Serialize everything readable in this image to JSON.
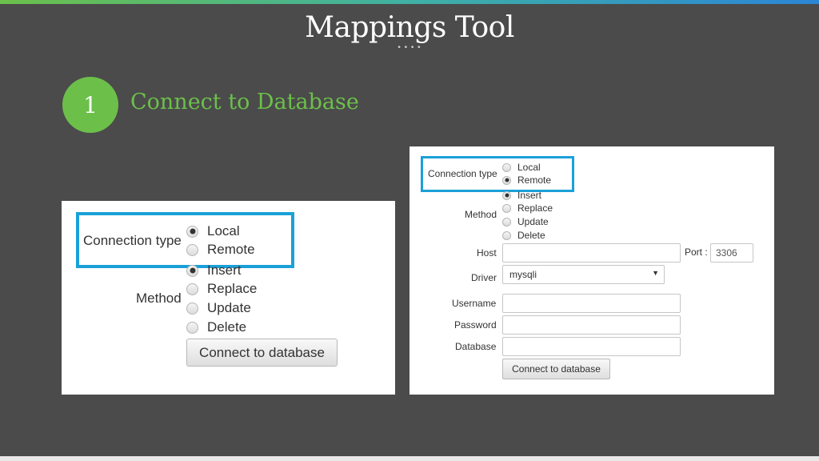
{
  "slide": {
    "title": "Mappings Tool",
    "title_dots": "• • • •",
    "step_number": "1",
    "step_title": "Connect to Database"
  },
  "left_form": {
    "connection_type_label": "Connection type",
    "connection_options": [
      {
        "label": "Local",
        "checked": true
      },
      {
        "label": "Remote",
        "checked": false
      }
    ],
    "method_label": "Method",
    "method_options": [
      {
        "label": "Insert",
        "checked": true
      },
      {
        "label": "Replace",
        "checked": false
      },
      {
        "label": "Update",
        "checked": false
      },
      {
        "label": "Delete",
        "checked": false
      }
    ],
    "connect_button": "Connect to database"
  },
  "right_form": {
    "connection_type_label": "Connection type",
    "connection_options": [
      {
        "label": "Local",
        "checked": false
      },
      {
        "label": "Remote",
        "checked": true
      }
    ],
    "method_label": "Method",
    "method_options": [
      {
        "label": "Insert",
        "checked": true
      },
      {
        "label": "Replace",
        "checked": false
      },
      {
        "label": "Update",
        "checked": false
      },
      {
        "label": "Delete",
        "checked": false
      }
    ],
    "host_label": "Host",
    "host_value": "",
    "port_label": "Port :",
    "port_value": "3306",
    "driver_label": "Driver",
    "driver_selected": "mysqli",
    "username_label": "Username",
    "username_value": "",
    "password_label": "Password",
    "password_value": "",
    "database_label": "Database",
    "database_value": "",
    "connect_button": "Connect to database"
  },
  "colors": {
    "background": "#4b4b4b",
    "accent_green": "#6cc04a",
    "highlight_blue": "#1aa0d8"
  }
}
